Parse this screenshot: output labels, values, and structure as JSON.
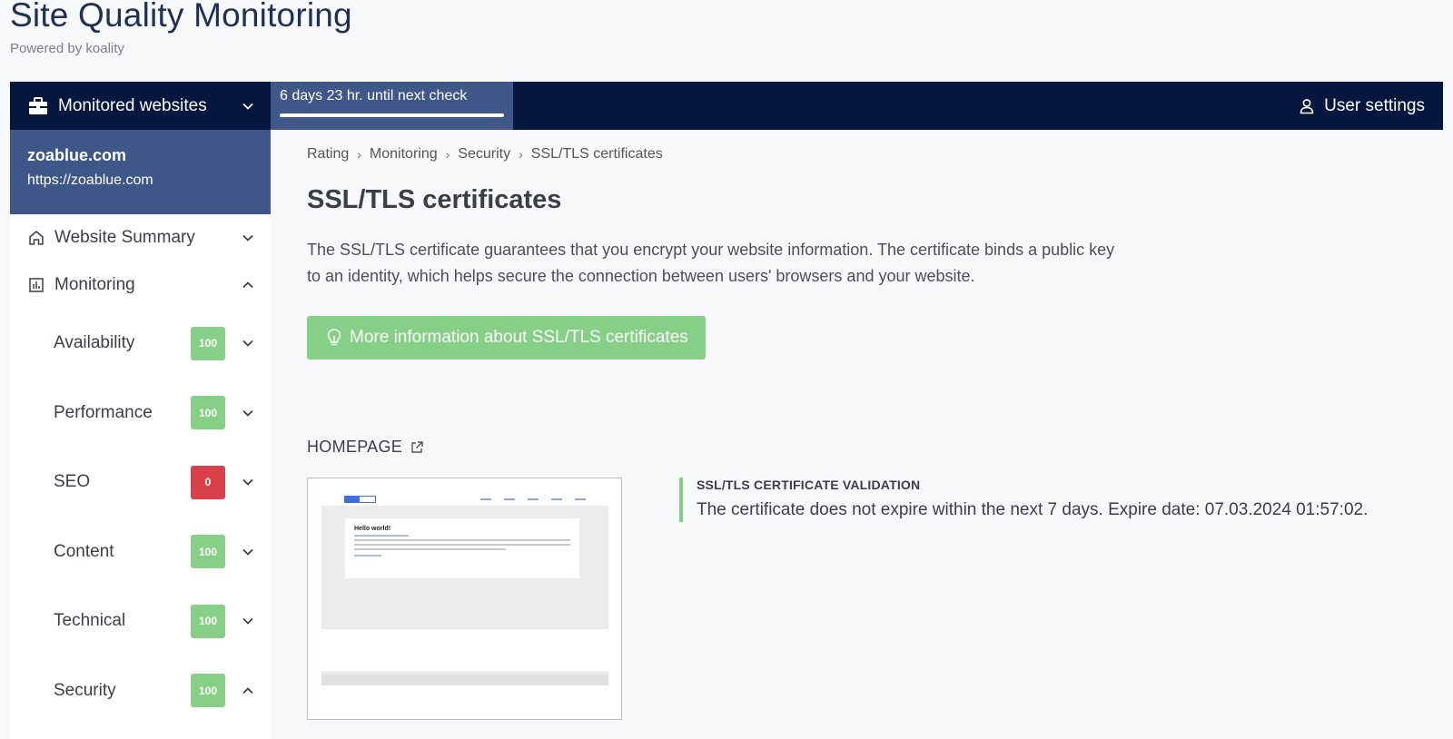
{
  "header": {
    "title": "Site Quality Monitoring",
    "subtitle": "Powered by koality"
  },
  "topbar": {
    "sites_label": "Monitored websites",
    "next_check": "6 days 23 hr. until next check",
    "next_check_progress": 1.0,
    "user_settings": "User settings"
  },
  "site": {
    "name": "zoablue.com",
    "url": "https://zoablue.com"
  },
  "nav": {
    "summary": "Website Summary",
    "monitoring": "Monitoring",
    "items": [
      {
        "label": "Availability",
        "score": "100",
        "status": "green"
      },
      {
        "label": "Performance",
        "score": "100",
        "status": "green"
      },
      {
        "label": "SEO",
        "score": "0",
        "status": "red"
      },
      {
        "label": "Content",
        "score": "100",
        "status": "green"
      },
      {
        "label": "Technical",
        "score": "100",
        "status": "green"
      },
      {
        "label": "Security",
        "score": "100",
        "status": "green"
      }
    ]
  },
  "breadcrumb": [
    "Rating",
    "Monitoring",
    "Security",
    "SSL/TLS certificates"
  ],
  "main": {
    "title": "SSL/TLS certificates",
    "description": "The SSL/TLS certificate guarantees that you encrypt your website information. The certificate binds a public key to an identity, which helps secure the connection between users' browsers and your website.",
    "more_info": "More information about SSL/TLS certificates",
    "section": "HOMEPAGE",
    "validation_title": "SSL/TLS CERTIFICATE VALIDATION",
    "validation_message": "The certificate does not expire within the next 7 days. Expire date: 07.03.2024 01:57:02."
  },
  "preview": {
    "hello": "Hello world!"
  },
  "colors": {
    "navy": "#06173f",
    "accent_blue": "#3e5688",
    "green": "#86cf86",
    "red": "#d9404a"
  }
}
